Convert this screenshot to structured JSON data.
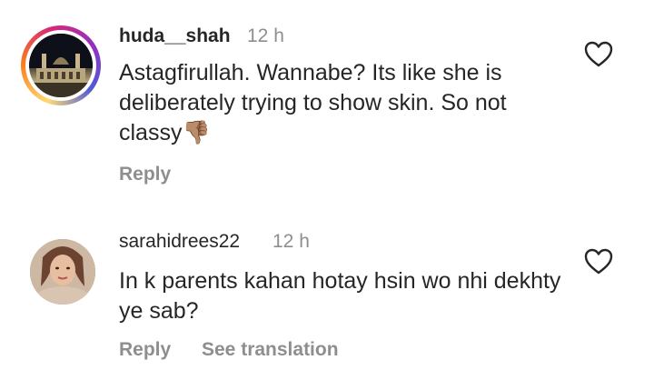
{
  "comments": [
    {
      "username": "huda__shah",
      "time": "12 h",
      "text": "Astagfirullah. Wannabe? Its like she is deliberately trying to show skin. So not classy",
      "emoji": "👎🏽",
      "reply_label": "Reply",
      "like_icon": "heart-icon"
    },
    {
      "username": "sarahidrees22",
      "time": "12 h",
      "text": "In k parents kahan hotay hsin wo nhi dekhty ye sab?",
      "reply_label": "Reply",
      "translate_label": "See translation",
      "like_icon": "heart-icon"
    }
  ],
  "colors": {
    "text": "#262626",
    "muted": "#8e8e8e",
    "background": "#ffffff"
  }
}
